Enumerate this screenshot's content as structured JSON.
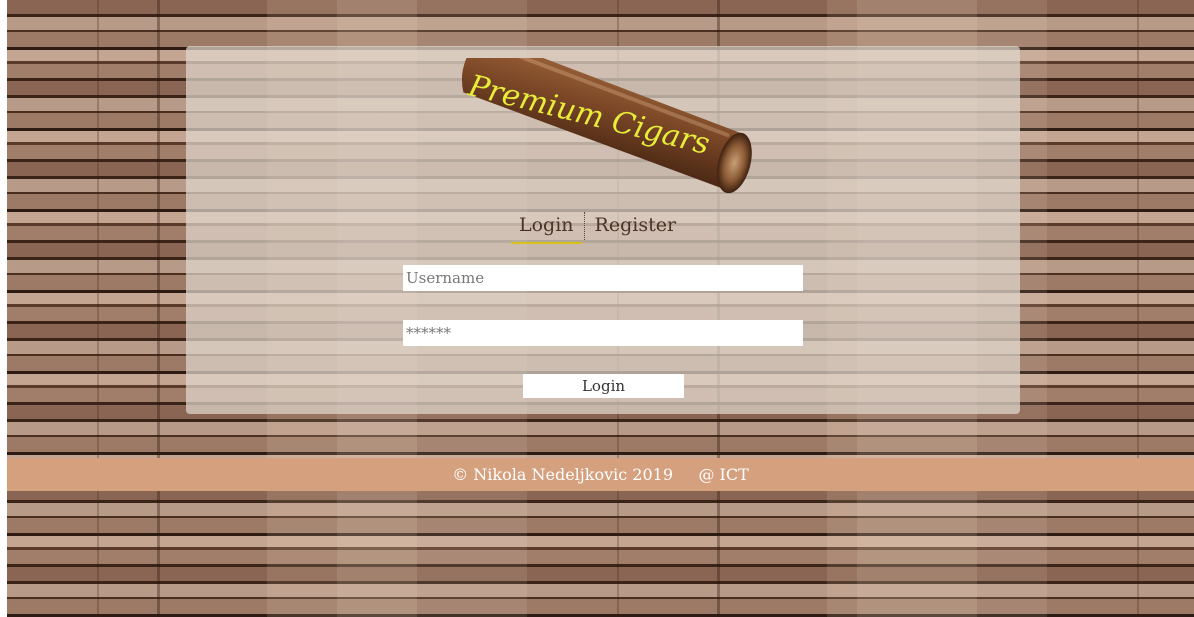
{
  "logo": {
    "text": "Premium Cigars"
  },
  "tabs": [
    {
      "label": "Login",
      "active": true
    },
    {
      "label": "Register",
      "active": false
    }
  ],
  "form": {
    "username_placeholder": "Username",
    "username_value": "",
    "password_placeholder": "******",
    "password_value": "",
    "submit_label": "Login"
  },
  "footer": {
    "copyright": "© Nikola Nedeljkovic 2019",
    "org": "@ ICT"
  },
  "colors": {
    "footer_bg": "#d4a07e",
    "active_tab_underline": "#d6c21a",
    "logo_text": "#e8ec3a",
    "cigar": "#7a4a2a"
  },
  "icons": {
    "logo": "cigar-logo-icon"
  }
}
